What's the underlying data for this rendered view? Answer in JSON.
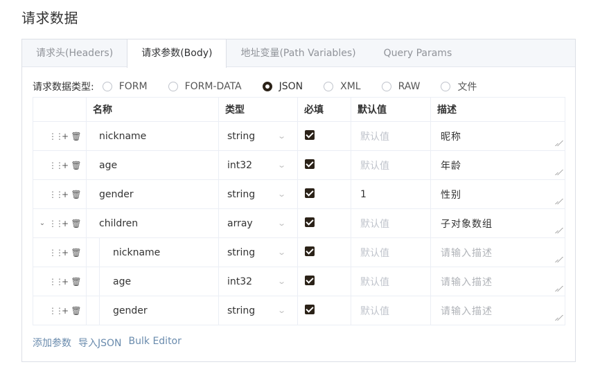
{
  "page_title": "请求数据",
  "tabs": [
    {
      "label": "请求头(Headers)",
      "active": false
    },
    {
      "label": "请求参数(Body)",
      "active": true
    },
    {
      "label": "地址变量(Path Variables)",
      "active": false
    },
    {
      "label": "Query Params",
      "active": false
    }
  ],
  "body_type": {
    "label": "请求数据类型:",
    "options": [
      "FORM",
      "FORM-DATA",
      "JSON",
      "XML",
      "RAW",
      "文件"
    ],
    "selected": "JSON"
  },
  "table": {
    "headers": [
      "",
      "名称",
      "类型",
      "必填",
      "默认值",
      "描述"
    ],
    "default_placeholder": "默认值",
    "desc_placeholder": "请输入描述",
    "rows": [
      {
        "name": "nickname",
        "type": "string",
        "required": true,
        "default": "",
        "desc": "昵称",
        "child": false,
        "expandable": false
      },
      {
        "name": "age",
        "type": "int32",
        "required": true,
        "default": "",
        "desc": "年龄",
        "child": false,
        "expandable": false
      },
      {
        "name": "gender",
        "type": "string",
        "required": true,
        "default": "1",
        "desc": "性别",
        "child": false,
        "expandable": false
      },
      {
        "name": "children",
        "type": "array",
        "required": true,
        "default": "",
        "desc": "子对象数组",
        "child": false,
        "expandable": true
      },
      {
        "name": "nickname",
        "type": "string",
        "required": true,
        "default": "",
        "desc": "",
        "child": true,
        "expandable": false
      },
      {
        "name": "age",
        "type": "int32",
        "required": true,
        "default": "",
        "desc": "",
        "child": true,
        "expandable": false
      },
      {
        "name": "gender",
        "type": "string",
        "required": true,
        "default": "",
        "desc": "",
        "child": true,
        "expandable": false
      }
    ]
  },
  "footer": {
    "add_param": "添加参数",
    "import_json": "导入JSON",
    "bulk_editor": "Bulk Editor"
  },
  "colors": {
    "accent": "#2b2218",
    "link": "#6a8bad",
    "border": "#ebeef5"
  }
}
